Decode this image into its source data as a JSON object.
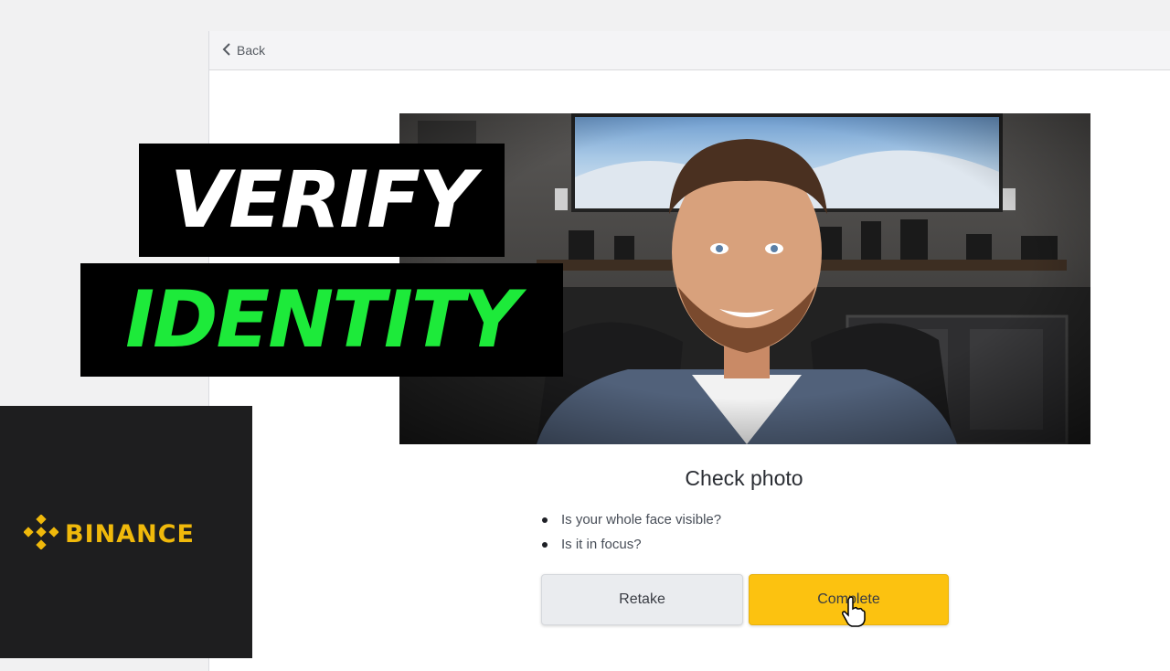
{
  "nav": {
    "back_label": "Back"
  },
  "overlay": {
    "title_line1": "VERIFY",
    "title_line2": "IDENTITY",
    "brand_name": "BINANCE"
  },
  "check": {
    "title": "Check photo",
    "items": [
      "Is your whole face visible?",
      "Is it in focus?"
    ]
  },
  "buttons": {
    "retake_label": "Retake",
    "complete_label": "Complete"
  },
  "colors": {
    "accent_yellow": "#FCC210",
    "brand_yellow": "#F0B90B",
    "headline_green": "#1DEA3A"
  }
}
